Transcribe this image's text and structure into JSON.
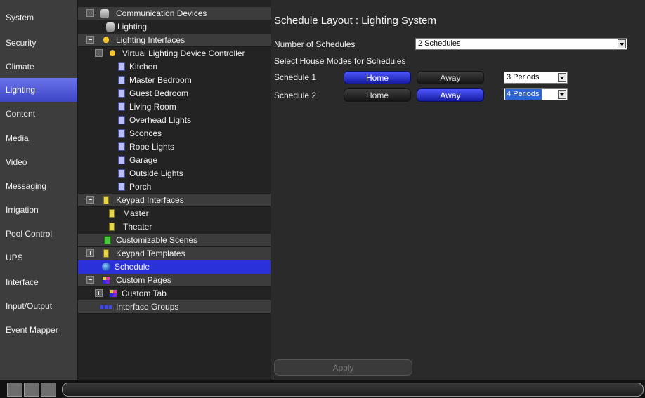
{
  "nav": {
    "items": [
      {
        "label": "System"
      },
      {
        "label": "Security"
      },
      {
        "label": "Climate"
      },
      {
        "label": "Lighting",
        "active": true
      },
      {
        "label": "Content"
      },
      {
        "label": "Media"
      },
      {
        "label": "Video"
      },
      {
        "label": "Messaging"
      },
      {
        "label": "Irrigation"
      },
      {
        "label": "Pool Control"
      },
      {
        "label": "UPS"
      },
      {
        "label": "Interface"
      },
      {
        "label": "Input/Output"
      },
      {
        "label": "Event Mapper"
      }
    ]
  },
  "tree": {
    "communication_devices": "Communication Devices",
    "lighting": "Lighting",
    "lighting_interfaces": "Lighting Interfaces",
    "virtual_controller": "Virtual Lighting Device Controller",
    "lights": [
      "Kitchen",
      "Master Bedroom",
      "Guest Bedroom",
      "Living Room",
      "Overhead Lights",
      "Sconces",
      "Rope Lights",
      "Garage",
      "Outside Lights",
      "Porch"
    ],
    "keypad_interfaces": "Keypad Interfaces",
    "keypads": [
      "Master",
      "Theater"
    ],
    "customizable_scenes": "Customizable Scenes",
    "keypad_templates": "Keypad Templates",
    "schedule": "Schedule",
    "custom_pages": "Custom Pages",
    "custom_tab": "Custom Tab",
    "interface_groups": "Interface Groups"
  },
  "main": {
    "title": "Schedule Layout : Lighting System",
    "num_schedules_label": "Number of Schedules",
    "num_schedules_value": "2 Schedules",
    "house_modes_label": "Select House Modes for Schedules",
    "schedules": [
      {
        "label": "Schedule 1",
        "home": "Home",
        "away": "Away",
        "active_mode": "Home",
        "periods": "3 Periods"
      },
      {
        "label": "Schedule 2",
        "home": "Home",
        "away": "Away",
        "active_mode": "Away",
        "periods": "4 Periods"
      }
    ],
    "apply_label": "Apply"
  },
  "colors": {
    "accent": "#2a31d8",
    "nav_active": "#5159dc",
    "panel": "#2a2a2a"
  }
}
